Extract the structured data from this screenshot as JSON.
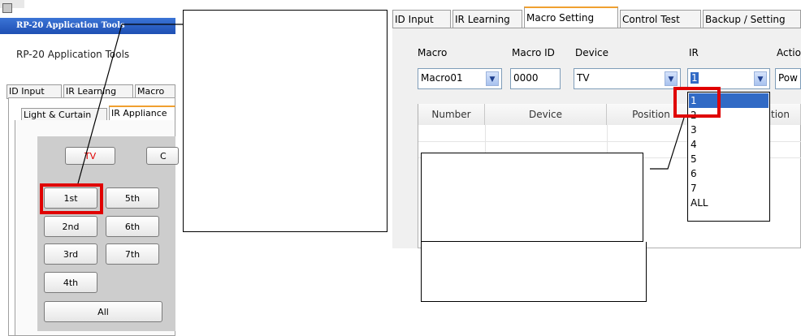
{
  "left_window": {
    "title": "RP-20 Application Tools",
    "app_label": "RP-20 Application Tools",
    "tabs": [
      "ID Input",
      "IR Learning",
      "Macro"
    ],
    "subtabs": [
      "Light & Curtain",
      "IR Appliance"
    ],
    "device_buttons": [
      "TV",
      "C"
    ],
    "zone_buttons": [
      "1st",
      "5th",
      "2nd",
      "6th",
      "3rd",
      "7th",
      "4th"
    ],
    "all_button": "All"
  },
  "right_window": {
    "tabs": [
      "ID Input",
      "IR Learning",
      "Macro Setting",
      "Control Test",
      "Backup / Setting"
    ],
    "active_tab": "Macro Setting",
    "labels": {
      "macro": "Macro",
      "macro_id": "Macro ID",
      "device": "Device",
      "ir": "IR",
      "action": "Actio"
    },
    "values": {
      "macro": "Macro01",
      "macro_id": "0000",
      "device": "TV",
      "ir": "1",
      "action": "Pow"
    },
    "grid_headers": [
      "Number",
      "Device",
      "Position",
      "tion"
    ],
    "ir_options": [
      "1",
      "2",
      "3",
      "4",
      "5",
      "6",
      "7",
      "ALL"
    ],
    "ir_selected": "1"
  },
  "colors": {
    "highlight": "#e00000",
    "selection": "#316ac5",
    "tab_accent": "#f0a030",
    "title_bar": "#1e4fb3"
  },
  "icons": [
    "window-app-icon",
    "dropdown-arrow-icon"
  ]
}
